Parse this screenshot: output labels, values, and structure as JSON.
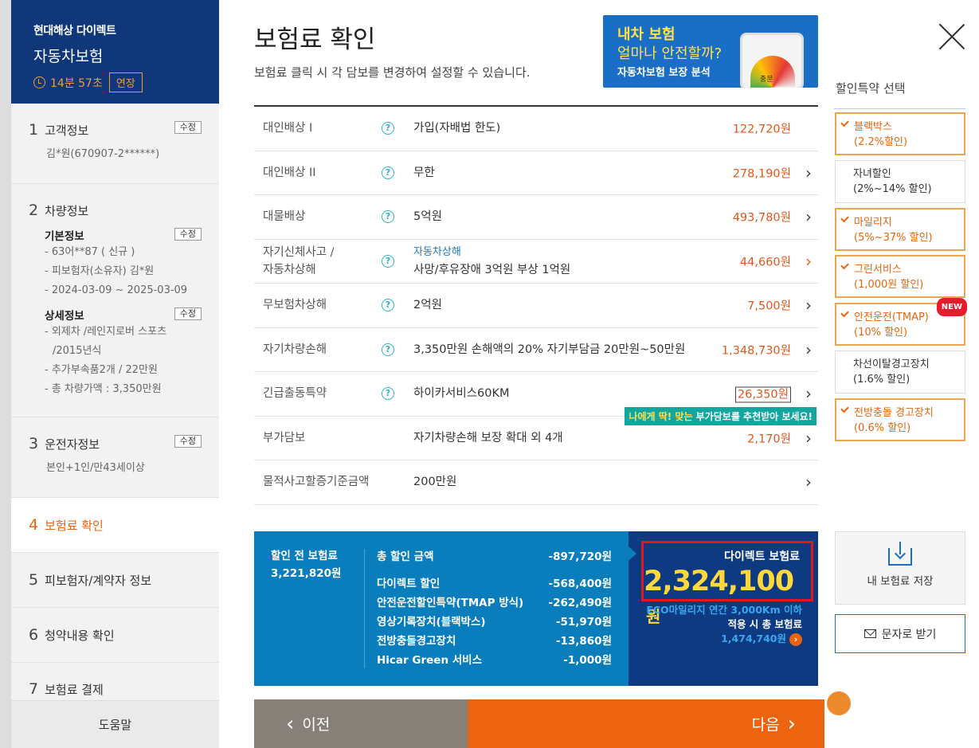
{
  "sidebar": {
    "company": "현대해상 다이렉트",
    "product": "자동차보험",
    "timer": "14분 57초",
    "extend_label": "연장",
    "edit_label": "수정",
    "steps": [
      {
        "num": "1",
        "label": "고객정보",
        "detail": "김*원(670907-2******)"
      },
      {
        "num": "2",
        "label": "차량정보",
        "basic_title": "기본정보",
        "basic_items": [
          "- 63어**87 ( 신규 )",
          "- 피보험자(소유자) 김*원",
          "- 2024-03-09 ~ 2025-03-09"
        ],
        "detail_title": "상세정보",
        "detail_items": [
          "- 외제차 /레인지로버 스포츠",
          "/2015년식",
          "- 추가부속품2개 / 22만원",
          "- 총 차량가액 : 3,350만원"
        ]
      },
      {
        "num": "3",
        "label": "운전자정보",
        "detail": "본인+1인/만43세이상"
      },
      {
        "num": "4",
        "label": "보험료 확인"
      },
      {
        "num": "5",
        "label": "피보험자/계약자 정보"
      },
      {
        "num": "6",
        "label": "청약내용 확인"
      },
      {
        "num": "7",
        "label": "보험료 결제"
      }
    ],
    "help": "도움말"
  },
  "main": {
    "title": "보험료 확인",
    "subtitle": "보험료 클릭 시 각 담보를 변경하여 설정할 수 있습니다.",
    "banner": {
      "line1": "내차 보험",
      "line2": "얼마나 안전할까?",
      "line3": "자동차보험 보장 분석",
      "gauge_label": "충분"
    },
    "coverages": [
      {
        "name": "대인배상 Ⅰ",
        "value": "가입(자배법 한도)",
        "price": "122,720원"
      },
      {
        "name": "대인배상 II",
        "value": "무한",
        "price": "278,190원"
      },
      {
        "name": "대물배상",
        "value": "5억원",
        "price": "493,780원"
      },
      {
        "name1": "자기신체사고 /",
        "name2": "자동차상해",
        "tag": "자동차상해",
        "value": "사망/후유장애 3억원 부상 1억원",
        "price": "44,660원"
      },
      {
        "name": "무보험차상해",
        "value": "2억원",
        "price": "7,500원"
      },
      {
        "name": "자기차량손해",
        "value": "3,350만원 손해액의 20% 자기부담금 20만원~50만원",
        "price": "1,348,730원"
      },
      {
        "name": "긴급출동특약",
        "value": "하이카서비스60KM",
        "price": "26,350원"
      },
      {
        "name": "부가담보",
        "value": "자기차량손해 보장 확대 외 4개",
        "price": "2,170원"
      },
      {
        "name": "물적사고할증기준금액",
        "value": "200만원"
      }
    ],
    "tooltip": {
      "highlight": "나에게 딱! 맞는",
      "text": " 부가담보를 추천받아 보세요!"
    },
    "summary": {
      "pre_label": "할인 전 보험료",
      "pre_amount": "3,221,820원",
      "total_discount_label": "총 할인 금액",
      "total_discount": "-897,720원",
      "items": [
        {
          "label": "다이렉트 할인",
          "amount": "-568,400원"
        },
        {
          "label": "안전운전할인특약(TMAP 방식)",
          "amount": "-262,490원"
        },
        {
          "label": "영상기록장치(블랙박스)",
          "amount": "-51,970원"
        },
        {
          "label": "전방충돌경고장치",
          "amount": "-13,860원"
        },
        {
          "label": "Hicar Green 서비스",
          "amount": "-1,000원"
        }
      ],
      "final_label": "다이렉트 보험료",
      "final_amount": "2,324,100",
      "final_unit": "원",
      "eco_line1": "ECO마일리지 연간 3,000Km 이하",
      "eco_line2": "적용 시 총 보험료",
      "eco_amount": "1,474,740원"
    },
    "prev_label": "이전",
    "next_label": "다음"
  },
  "discounts": {
    "title": "할인특약 선택",
    "items": [
      {
        "label": "블랙박스",
        "detail": "(2.2%할인)",
        "selected": true
      },
      {
        "label": "자녀할인",
        "detail": "(2%~14% 할인)",
        "selected": false
      },
      {
        "label": "마일리지",
        "detail": "(5%~37% 할인)",
        "selected": true
      },
      {
        "label": "그린서비스",
        "detail": "(1,000원 할인)",
        "selected": true
      },
      {
        "label": "안전운전(TMAP)",
        "detail": "(10% 할인)",
        "selected": true,
        "badge": "NEW"
      },
      {
        "label": "차선이탈경고장치",
        "detail": "(1.6% 할인)",
        "selected": false
      },
      {
        "label": "전방충돌 경고장치",
        "detail": "(0.6% 할인)",
        "selected": true
      }
    ],
    "save_label": "내 보험료 저장",
    "sms_label": "문자로 받기"
  }
}
